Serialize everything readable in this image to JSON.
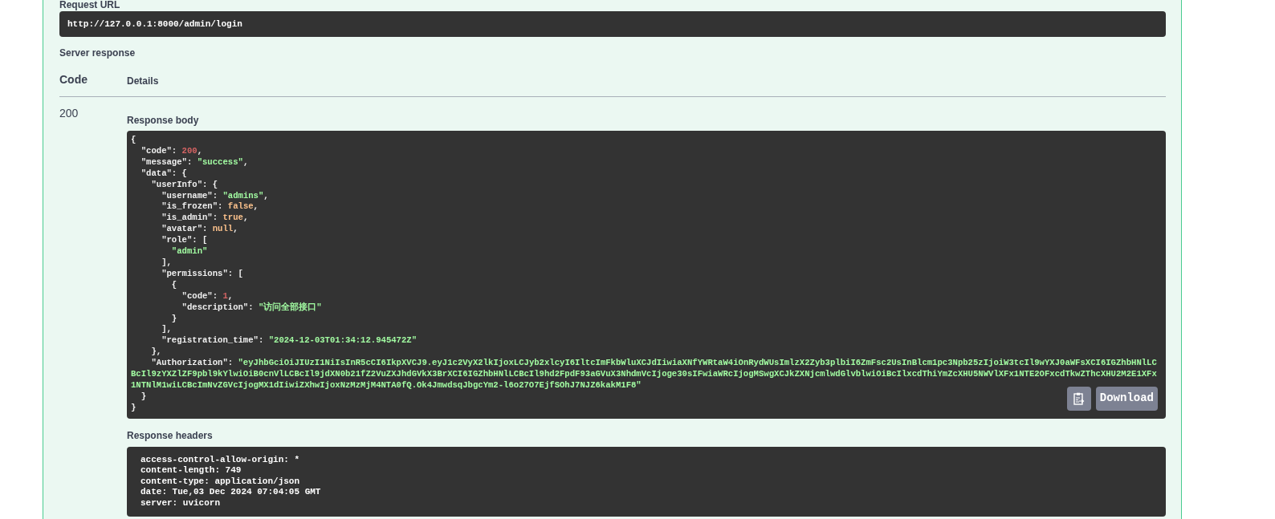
{
  "request_url": {
    "label": "Request URL",
    "value": "http://127.0.0.1:8000/admin/login"
  },
  "server_response": {
    "title": "Server response",
    "columns": [
      "Code",
      "Details"
    ],
    "responses": [
      {
        "code": "200",
        "body_label": "Response body",
        "body_lines": [
          [
            {
              "kind": "plain",
              "text": "{"
            }
          ],
          [
            {
              "kind": "plain",
              "text": "  \"code\": "
            },
            {
              "kind": "number",
              "text": "200"
            },
            {
              "kind": "plain",
              "text": ","
            }
          ],
          [
            {
              "kind": "plain",
              "text": "  \"message\": "
            },
            {
              "kind": "string",
              "text": "\"success\""
            },
            {
              "kind": "plain",
              "text": ","
            }
          ],
          [
            {
              "kind": "plain",
              "text": "  \"data\": {"
            }
          ],
          [
            {
              "kind": "plain",
              "text": "    \"userInfo\": {"
            }
          ],
          [
            {
              "kind": "plain",
              "text": "      \"username\": "
            },
            {
              "kind": "string",
              "text": "\"admins\""
            },
            {
              "kind": "plain",
              "text": ","
            }
          ],
          [
            {
              "kind": "plain",
              "text": "      \"is_frozen\": "
            },
            {
              "kind": "literal",
              "text": "false"
            },
            {
              "kind": "plain",
              "text": ","
            }
          ],
          [
            {
              "kind": "plain",
              "text": "      \"is_admin\": "
            },
            {
              "kind": "literal",
              "text": "true"
            },
            {
              "kind": "plain",
              "text": ","
            }
          ],
          [
            {
              "kind": "plain",
              "text": "      \"avatar\": "
            },
            {
              "kind": "literal",
              "text": "null"
            },
            {
              "kind": "plain",
              "text": ","
            }
          ],
          [
            {
              "kind": "plain",
              "text": "      \"role\": ["
            }
          ],
          [
            {
              "kind": "string",
              "text": "        \"admin\""
            }
          ],
          [
            {
              "kind": "plain",
              "text": "      ],"
            }
          ],
          [
            {
              "kind": "plain",
              "text": "      \"permissions\": ["
            }
          ],
          [
            {
              "kind": "plain",
              "text": "        {"
            }
          ],
          [
            {
              "kind": "plain",
              "text": "          \"code\": "
            },
            {
              "kind": "number",
              "text": "1"
            },
            {
              "kind": "plain",
              "text": ","
            }
          ],
          [
            {
              "kind": "plain",
              "text": "          \"description\": "
            },
            {
              "kind": "string",
              "text": "\"访问全部接口\""
            }
          ],
          [
            {
              "kind": "plain",
              "text": "        }"
            }
          ],
          [
            {
              "kind": "plain",
              "text": "      ],"
            }
          ],
          [
            {
              "kind": "plain",
              "text": "      \"registration_time\": "
            },
            {
              "kind": "string",
              "text": "\"2024-12-03T01:34:12.945472Z\""
            }
          ],
          [
            {
              "kind": "plain",
              "text": "    },"
            }
          ],
          [
            {
              "kind": "plain",
              "text": "    \"Authorization\": "
            },
            {
              "kind": "string",
              "text": "\"eyJhbGciOiJIUzI1NiIsInR5cCI6IkpXVCJ9.eyJ1c2VyX2lkIjoxLCJyb2xlcyI6IltcImFkbWluXCJdIiwiaXNfYWRtaW4iOnRydWUsImlzX2Zyb3plbiI6ZmFsc2UsInBlcm1pc3Npb25zIjoiW3tcIl9wYXJ0aWFsXCI6IGZhbHNlLCBcIl9zYXZlZF9pbl9kYlwiOiB0cnVlLCBcIl9jdXN0b21fZ2VuZXJhdGVkX3BrXCI6IGZhbHNlLCBcIl9hd2FpdF93aGVuX3NhdmVcIjoge30sIFwiaWRcIjogMSwgXCJkZXNjcmlwdGlvblwiOiBcIlxcdThiYmZcXHU5NWVlXFx1NTE2OFxcdTkwZThcXHU2M2E1XFx1NTNlM1wiLCBcImNvZGVcIjogMX1dIiwiZXhwIjoxNzMzMjM4NTA0fQ.Ok4JmwdsqJbgcYm2-l6o27O7EjfSOhJ7NJZ6kakM1F8\""
            }
          ],
          [
            {
              "kind": "plain",
              "text": "  }"
            }
          ],
          [
            {
              "kind": "plain",
              "text": "}"
            }
          ]
        ],
        "download_label": "Download",
        "headers_label": "Response headers",
        "header_lines": [
          "access-control-allow-origin: *",
          "content-length: 749",
          "content-type: application/json",
          "date: Tue,03 Dec 2024 07:04:05 GMT",
          "server: uvicorn"
        ]
      }
    ]
  }
}
